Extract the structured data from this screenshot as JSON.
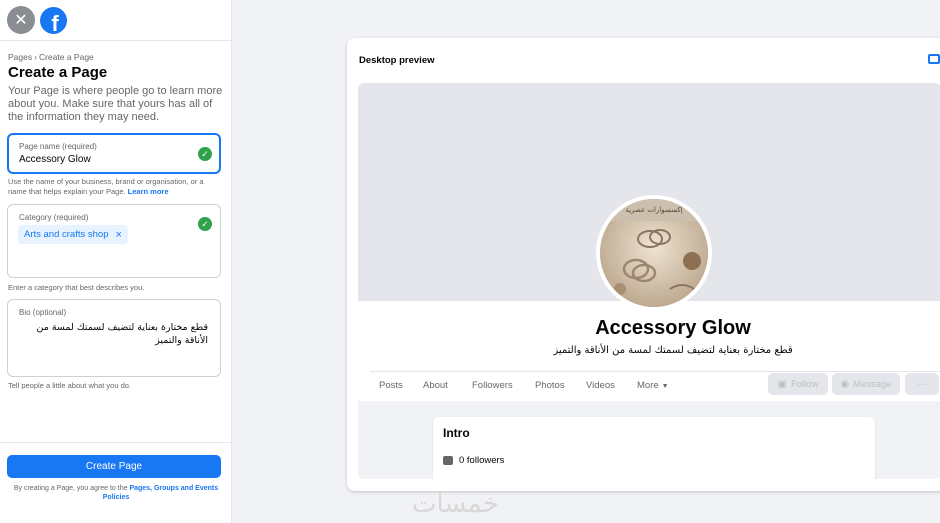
{
  "breadcrumb": {
    "parent": "Pages",
    "separator": "›",
    "current": "Create a Page"
  },
  "form": {
    "title": "Create a Page",
    "description": "Your Page is where people go to learn more about you. Make sure that yours has all of the information they may need.",
    "page_name": {
      "label": "Page name (required)",
      "value": "Accessory Glow",
      "help": "Use the name of your business, brand or organisation, or a name that helps explain your Page.",
      "help_link": "Learn more"
    },
    "category": {
      "label": "Category (required)",
      "chip": "Arts and crafts shop",
      "chip_remove": "×",
      "help": "Enter a category that best describes you."
    },
    "bio": {
      "label": "Bio (optional)",
      "value": "قطع مختارة بعناية لتضيف لسمتك لمسة من الأناقة والتميز",
      "help": "Tell people a little about what you do."
    },
    "submit_label": "Create Page",
    "terms_prefix": "By creating a Page, you agree to the ",
    "terms_link": "Pages, Groups and Events Policies"
  },
  "preview": {
    "title": "Desktop preview",
    "page_name": "Accessory Glow",
    "page_bio": "قطع مختارة بعناية لتضيف لسمتك لمسة من الأناقة والتميز",
    "avatar_text": "إكسسوارات عصرية",
    "tabs": [
      "Posts",
      "About",
      "Followers",
      "Photos",
      "Videos",
      "More"
    ],
    "follow_label": "Follow",
    "message_label": "Message",
    "more_label": "···",
    "intro_title": "Intro",
    "followers_text": "0 followers"
  },
  "watermark": "خمسات",
  "colors": {
    "accent": "#1877f2",
    "success": "#31a24c"
  }
}
